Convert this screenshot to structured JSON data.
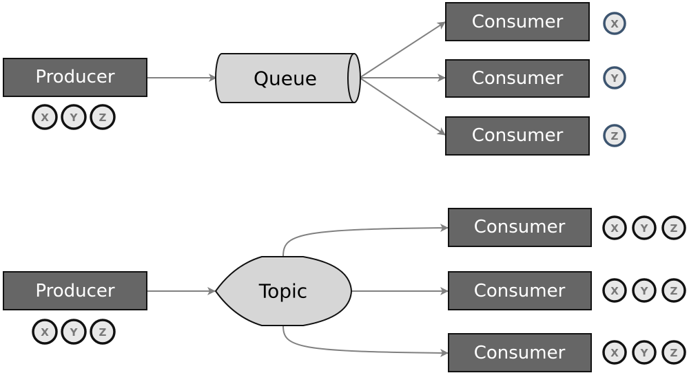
{
  "queue_section": {
    "producer": {
      "label": "Producer",
      "badges": [
        "X",
        "Y",
        "Z"
      ]
    },
    "queue": {
      "label": "Queue"
    },
    "consumers": [
      {
        "label": "Consumer",
        "badges": [
          "X"
        ]
      },
      {
        "label": "Consumer",
        "badges": [
          "Y"
        ]
      },
      {
        "label": "Consumer",
        "badges": [
          "Z"
        ]
      }
    ]
  },
  "topic_section": {
    "producer": {
      "label": "Producer",
      "badges": [
        "X",
        "Y",
        "Z"
      ]
    },
    "topic": {
      "label": "Topic"
    },
    "consumers": [
      {
        "label": "Consumer",
        "badges": [
          "X",
          "Y",
          "Z"
        ]
      },
      {
        "label": "Consumer",
        "badges": [
          "X",
          "Y",
          "Z"
        ]
      },
      {
        "label": "Consumer",
        "badges": [
          "X",
          "Y",
          "Z"
        ]
      }
    ]
  },
  "colors": {
    "box_fill": "#666666",
    "shape_fill": "#d6d6d6",
    "edge": "#808080",
    "producer_badge_stroke": "#111111",
    "queue_consumer_badge_stroke": "#3d5570"
  }
}
